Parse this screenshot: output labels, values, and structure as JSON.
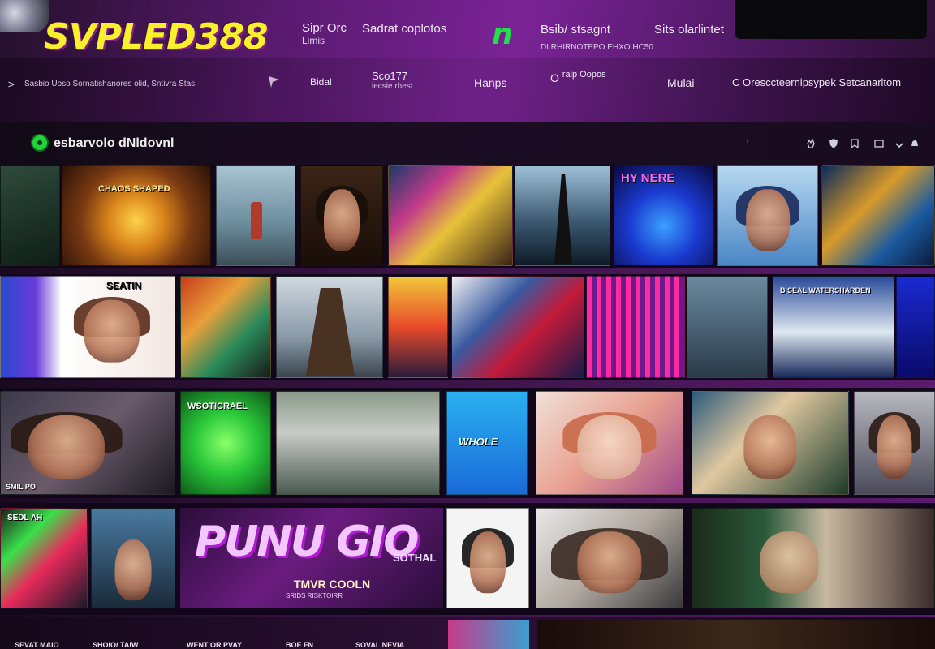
{
  "header": {
    "logo_text": "SVPLED388",
    "nav_top": [
      {
        "label": "Sipr Orc",
        "sub": "Limis"
      },
      {
        "label": "Sadrat coplotos"
      },
      {
        "label": "n"
      },
      {
        "label": "Bsib/ stsagnt",
        "sub": "DI RHIRNOTEPO EHXO HC50"
      },
      {
        "label": "Sits olarlintet"
      }
    ],
    "tagline": "Sasbio Uoso Sornatishanores olid, Sntivra Stas",
    "menu_icon": "≥",
    "sub_nav": [
      {
        "label": "Bidal"
      },
      {
        "label": "Sco177",
        "sub": "lecsie rhest"
      },
      {
        "label": "Hanps"
      },
      {
        "label": "O",
        "sub": "ralp Oopos"
      },
      {
        "label": "Mulai"
      },
      {
        "label": "C Oresccteernipsypek Setcanarltom"
      }
    ]
  },
  "section": {
    "title": "esbarvolo dNldovnl",
    "tool_icons": [
      "'",
      "hand-icon",
      "shield-icon",
      "bookmark-icon",
      "share-icon",
      "chevron-down-icon",
      "bell-icon"
    ]
  },
  "tiles": {
    "row1": [
      {
        "caption": ""
      },
      {
        "caption": "CHAOS SHAPED"
      },
      {
        "caption": ""
      },
      {
        "caption": ""
      },
      {
        "caption": ""
      },
      {
        "caption": ""
      },
      {
        "caption": ""
      },
      {
        "caption": "HY NERE"
      },
      {
        "caption": ""
      },
      {
        "caption": ""
      }
    ],
    "row2": [
      {
        "caption": "SEATIN"
      },
      {
        "caption": ""
      },
      {
        "caption": ""
      },
      {
        "caption": ""
      },
      {
        "caption": ""
      },
      {
        "caption": ""
      },
      {
        "caption": ""
      },
      {
        "caption": "B SEAL WATERSHARDEN"
      },
      {
        "caption": ""
      }
    ],
    "row3": [
      {
        "caption": "SMIL PO"
      },
      {
        "caption": "WSOTICRAEL"
      },
      {
        "caption": ""
      },
      {
        "caption": "WHOLE"
      },
      {
        "caption": ""
      },
      {
        "caption": ""
      },
      {
        "caption": ""
      }
    ],
    "row4": [
      {
        "caption": "SEDL AH"
      },
      {
        "caption": ""
      },
      {
        "caption": ""
      },
      {
        "caption": ""
      },
      {
        "caption": ""
      }
    ],
    "big_poster": {
      "title": "PUNU GIO",
      "side": "SOTHAL",
      "sub1": "TMVR COOLN",
      "sub2": "SRIDS RISKTOIRR"
    }
  },
  "footer": {
    "labels": [
      "SEVAT MAIO",
      "SHOIO/ TAIW",
      "WENT OR PVAY",
      "BOE FN",
      "SOVAL NEVIA"
    ]
  },
  "colors": {
    "logo": "#f7f02a",
    "green_logo": "#21e04a",
    "section_dot": "#23d33a",
    "bg_purple": "#5a1a70"
  }
}
